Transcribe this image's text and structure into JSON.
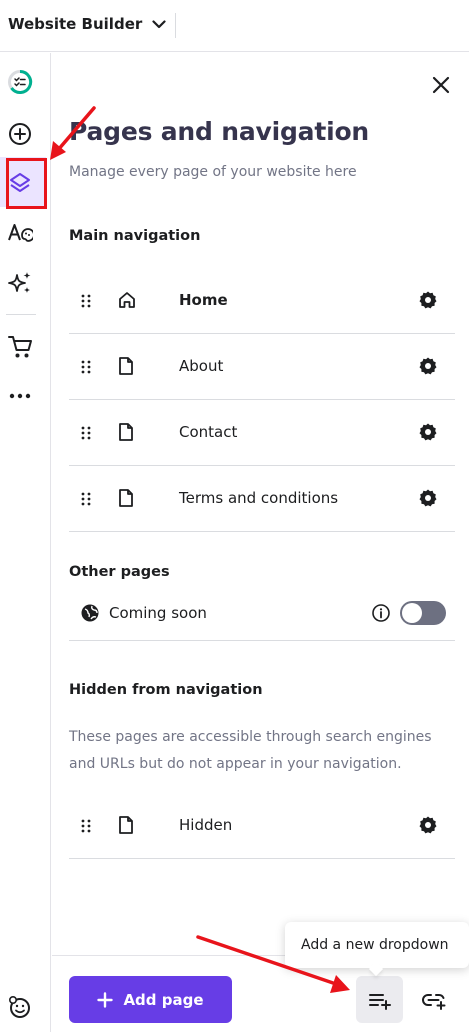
{
  "topbar": {
    "app_name": "Website Builder"
  },
  "sidebar": {
    "items": [
      {
        "icon": "checklist-progress-icon"
      },
      {
        "icon": "add-element-icon"
      },
      {
        "icon": "layers-icon",
        "active": true
      },
      {
        "icon": "styles-palette-icon"
      },
      {
        "icon": "ai-sparkle-icon"
      },
      {
        "icon": "cart-icon"
      },
      {
        "icon": "more-icon"
      }
    ],
    "bottom_icon": "feedback-smiley-icon"
  },
  "panel": {
    "title": "Pages and navigation",
    "subtitle": "Manage every page of your website here",
    "main_nav": {
      "heading": "Main navigation",
      "pages": [
        {
          "label": "Home",
          "icon": "home-icon",
          "bold": true
        },
        {
          "label": "About",
          "icon": "page-icon",
          "bold": false
        },
        {
          "label": "Contact",
          "icon": "page-icon",
          "bold": false
        },
        {
          "label": "Terms and conditions",
          "icon": "page-icon",
          "bold": false
        }
      ]
    },
    "other_pages": {
      "heading": "Other pages",
      "items": [
        {
          "label": "Coming soon",
          "icon": "globe-icon",
          "enabled": false
        }
      ]
    },
    "hidden": {
      "heading": "Hidden from navigation",
      "description": "These pages are accessible through search engines and URLs but do not appear in your navigation.",
      "pages": [
        {
          "label": "Hidden",
          "icon": "page-icon"
        }
      ]
    }
  },
  "footer": {
    "add_page_label": "Add page",
    "tooltip": "Add a new dropdown"
  },
  "colors": {
    "accent": "#673de6",
    "annotation": "#e8141b",
    "active_bg": "#ebe4ff"
  }
}
